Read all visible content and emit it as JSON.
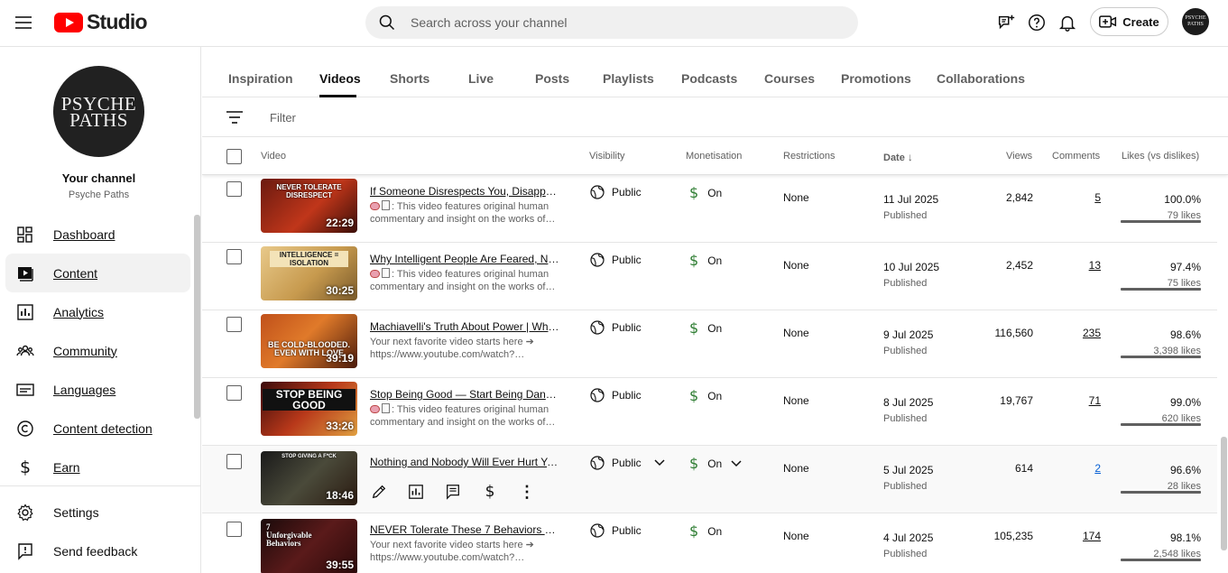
{
  "app": {
    "name": "Studio"
  },
  "search": {
    "placeholder": "Search across your channel"
  },
  "header": {
    "create_label": "Create",
    "avatar_text": "PSYCHE PATHS"
  },
  "channel": {
    "avatar_text_1": "PSYCHE",
    "avatar_text_2": "PATHS",
    "your_channel": "Your channel",
    "name": "Psyche Paths"
  },
  "sidebar": {
    "items": [
      {
        "label": "Dashboard",
        "icon": "dashboard-icon"
      },
      {
        "label": "Content",
        "icon": "content-icon"
      },
      {
        "label": "Analytics",
        "icon": "analytics-icon"
      },
      {
        "label": "Community",
        "icon": "community-icon"
      },
      {
        "label": "Languages",
        "icon": "languages-icon"
      },
      {
        "label": "Content detection",
        "icon": "copyright-icon"
      },
      {
        "label": "Earn",
        "icon": "dollar-icon"
      }
    ],
    "bottom": [
      {
        "label": "Settings",
        "icon": "gear-icon"
      },
      {
        "label": "Send feedback",
        "icon": "feedback-icon"
      }
    ]
  },
  "tabs": [
    "Inspiration",
    "Videos",
    "Shorts",
    "Live",
    "Posts",
    "Playlists",
    "Podcasts",
    "Courses",
    "Promotions",
    "Collaborations"
  ],
  "filter": {
    "placeholder": "Filter"
  },
  "table": {
    "columns": {
      "video": "Video",
      "visibility": "Visibility",
      "monetisation": "Monetisation",
      "restrictions": "Restrictions",
      "date": "Date",
      "views": "Views",
      "comments": "Comments",
      "likes": "Likes (vs dislikes)"
    },
    "rows": [
      {
        "title": "If Someone Disrespects You, Disappe…",
        "desc_has_emoji": true,
        "desc": ": This video features original human commentary and insight on the works of…",
        "duration": "22:29",
        "thumb_text": "NEVER TOLERATE DISRESPECT",
        "visibility": "Public",
        "monetisation": "On",
        "restrictions": "None",
        "date": "11 Jul 2025",
        "status": "Published",
        "views": "2,842",
        "comments": "5",
        "likes_pct": "100.0%",
        "likes": "79 likes"
      },
      {
        "title": "Why Intelligent People Are Feared, Not…",
        "desc_has_emoji": true,
        "desc": ": This video features original human commentary and insight on the works of…",
        "duration": "30:25",
        "thumb_text": "INTELLIGENCE = ISOLATION",
        "visibility": "Public",
        "monetisation": "On",
        "restrictions": "None",
        "date": "10 Jul 2025",
        "status": "Published",
        "views": "2,452",
        "comments": "13",
        "likes_pct": "97.4%",
        "likes": "75 likes"
      },
      {
        "title": "Machiavelli's Truth About Power | Why…",
        "desc_has_emoji": false,
        "desc": "Your next favorite video starts here ➔ https://www.youtube.com/watch?…",
        "duration": "39:19",
        "thumb_text": "BE COLD-BLOODED. EVEN WITH LOVE",
        "visibility": "Public",
        "monetisation": "On",
        "restrictions": "None",
        "date": "9 Jul 2025",
        "status": "Published",
        "views": "116,560",
        "comments": "235",
        "likes_pct": "98.6%",
        "likes": "3,398 likes"
      },
      {
        "title": "Stop Being Good — Start Being Danger…",
        "desc_has_emoji": true,
        "desc": ": This video features original human commentary and insight on the works of…",
        "duration": "33:26",
        "thumb_text": "STOP BEING GOOD",
        "visibility": "Public",
        "monetisation": "On",
        "restrictions": "None",
        "date": "8 Jul 2025",
        "status": "Published",
        "views": "19,767",
        "comments": "71",
        "likes_pct": "99.0%",
        "likes": "620 likes"
      },
      {
        "title": "Nothing and Nobody Will Ever Hurt Yo…",
        "desc_has_emoji": false,
        "desc": "",
        "duration": "18:46",
        "thumb_text": "STOP GIVING A F*CK",
        "visibility": "Public",
        "monetisation": "On",
        "restrictions": "None",
        "date": "5 Jul 2025",
        "status": "Published",
        "views": "614",
        "comments": "2",
        "likes_pct": "96.6%",
        "likes": "28 likes"
      },
      {
        "title": "NEVER Tolerate These 7 Behaviors — …",
        "desc_has_emoji": false,
        "desc": "Your next favorite video starts here ➔ https://www.youtube.com/watch?…",
        "duration": "39:55",
        "thumb_text": "7 Unforgivable Behaviors",
        "visibility": "Public",
        "monetisation": "On",
        "restrictions": "None",
        "date": "4 Jul 2025",
        "status": "Published",
        "views": "105,235",
        "comments": "174",
        "likes_pct": "98.1%",
        "likes": "2,548 likes"
      }
    ]
  },
  "colors": {
    "brand_red": "#ff0000",
    "monetisation_green": "#2e7d32",
    "link_blue": "#065fd4"
  }
}
